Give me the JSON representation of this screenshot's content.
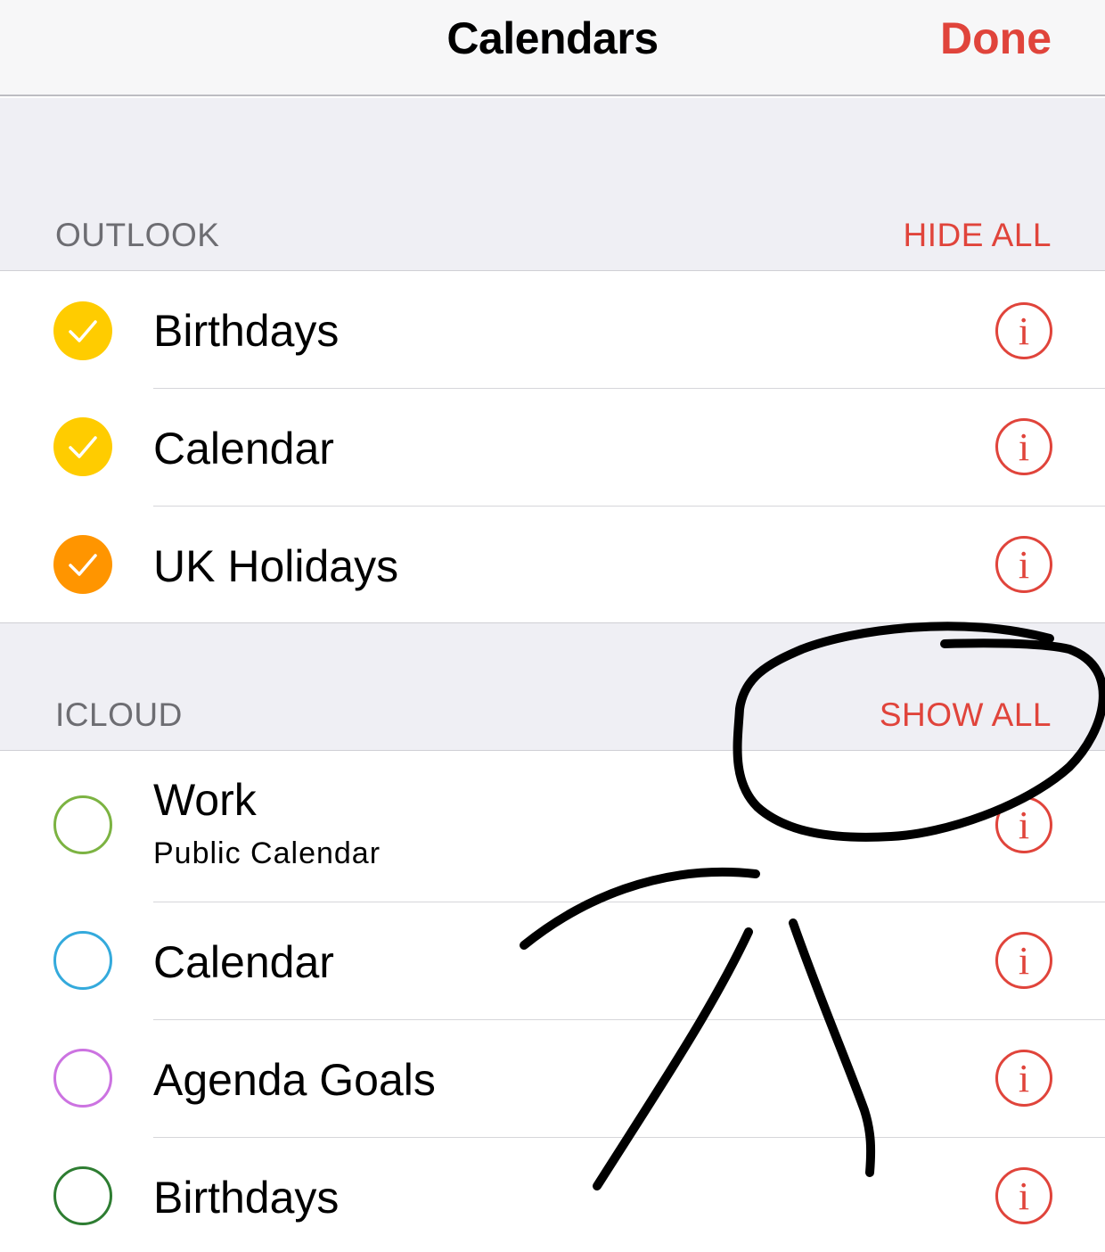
{
  "nav": {
    "title": "Calendars",
    "done_label": "Done"
  },
  "colors": {
    "accent": "#e0443b"
  },
  "sections": [
    {
      "title": "OUTLOOK",
      "action": "HIDE ALL",
      "items": [
        {
          "label": "Birthdays",
          "checked": true,
          "color": "#ffcc00"
        },
        {
          "label": "Calendar",
          "checked": true,
          "color": "#ffcc00"
        },
        {
          "label": "UK Holidays",
          "checked": true,
          "color": "#ff9500"
        }
      ]
    },
    {
      "title": "ICLOUD",
      "action": "SHOW ALL",
      "items": [
        {
          "label": "Work",
          "sublabel": "Public Calendar",
          "checked": false,
          "color": "#7cb342"
        },
        {
          "label": "Calendar",
          "checked": false,
          "color": "#34aadc"
        },
        {
          "label": "Agenda Goals",
          "checked": false,
          "color": "#cc73e1"
        },
        {
          "label": "Birthdays",
          "checked": false,
          "color": "#2e7d32"
        }
      ]
    }
  ],
  "icons": {
    "check": "checkmark-icon",
    "info": "info-icon"
  }
}
